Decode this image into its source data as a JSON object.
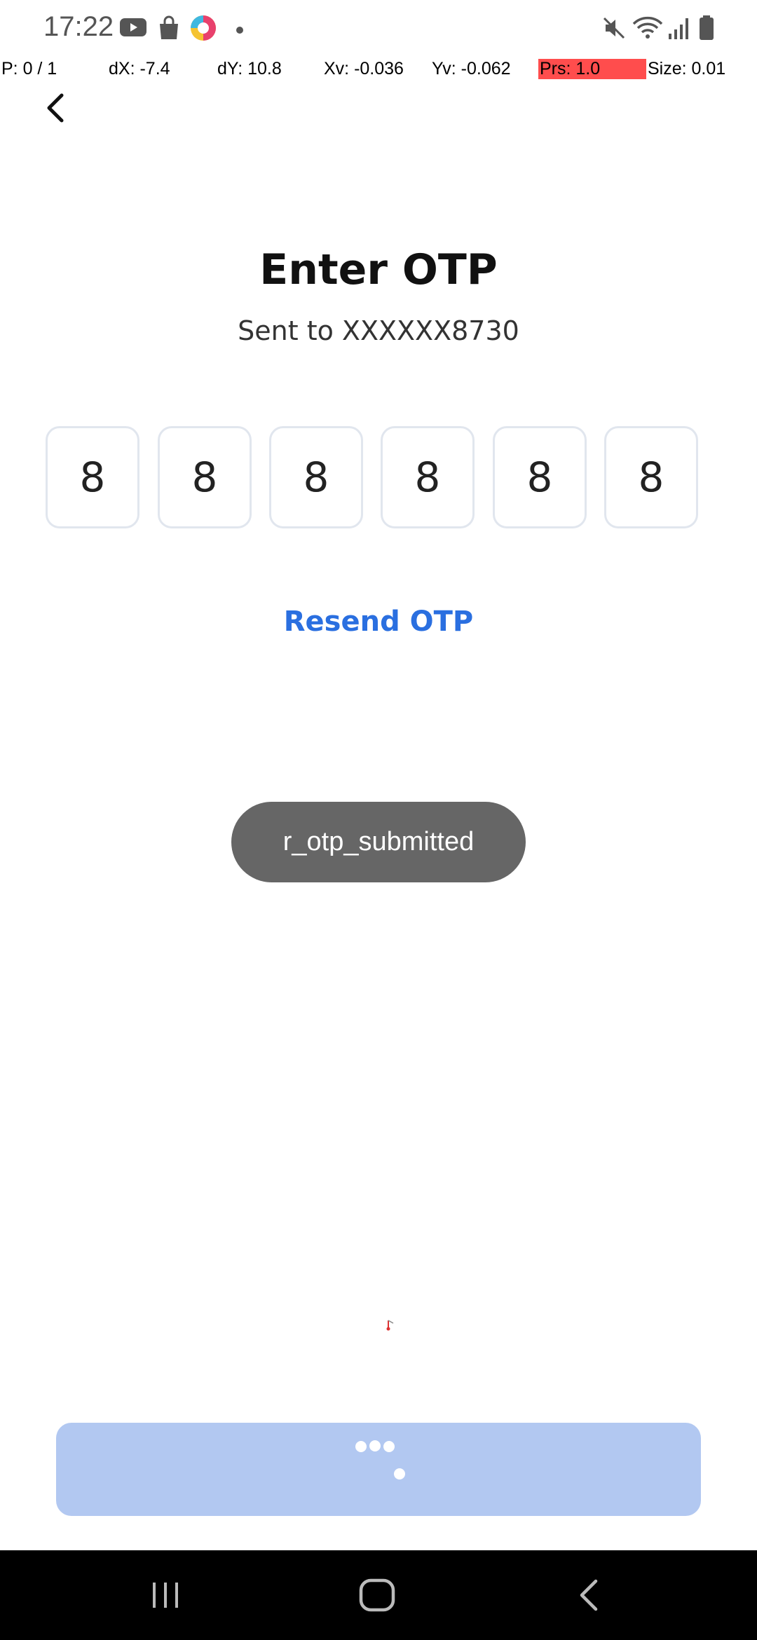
{
  "status_bar": {
    "time": "17:22",
    "left_icons": [
      "youtube-icon",
      "shopping-bag-icon",
      "app-logo-icon",
      "notification-dot-icon"
    ],
    "right_icons": [
      "mute-icon",
      "wifi-icon",
      "signal-icon",
      "battery-icon"
    ]
  },
  "debug": {
    "pointer": "P: 0 / 1",
    "dx": "dX: -7.4",
    "dy": "dY: 10.8",
    "xv": "Xv: -0.036",
    "yv": "Yv: -0.062",
    "prs": "Prs: 1.0",
    "size": "Size: 0.01"
  },
  "header": {
    "back_icon": "chevron-left-icon"
  },
  "otp": {
    "title": "Enter OTP",
    "subtitle": "Sent to XXXXXX8730",
    "digits": [
      "8",
      "8",
      "8",
      "8",
      "8",
      "8"
    ],
    "resend_label": "Resend OTP"
  },
  "toast": {
    "message": "r_otp_submitted"
  },
  "submit": {
    "state": "loading",
    "color": "#b2c8f1"
  },
  "nav": {
    "recent_icon": "recent-apps-icon",
    "home_icon": "home-icon",
    "back_icon": "back-icon"
  },
  "colors": {
    "accent": "#2a6fe0",
    "toast_bg": "#666666",
    "otp_border": "#e1e6ee",
    "debug_highlight": "#ff4d4d"
  }
}
